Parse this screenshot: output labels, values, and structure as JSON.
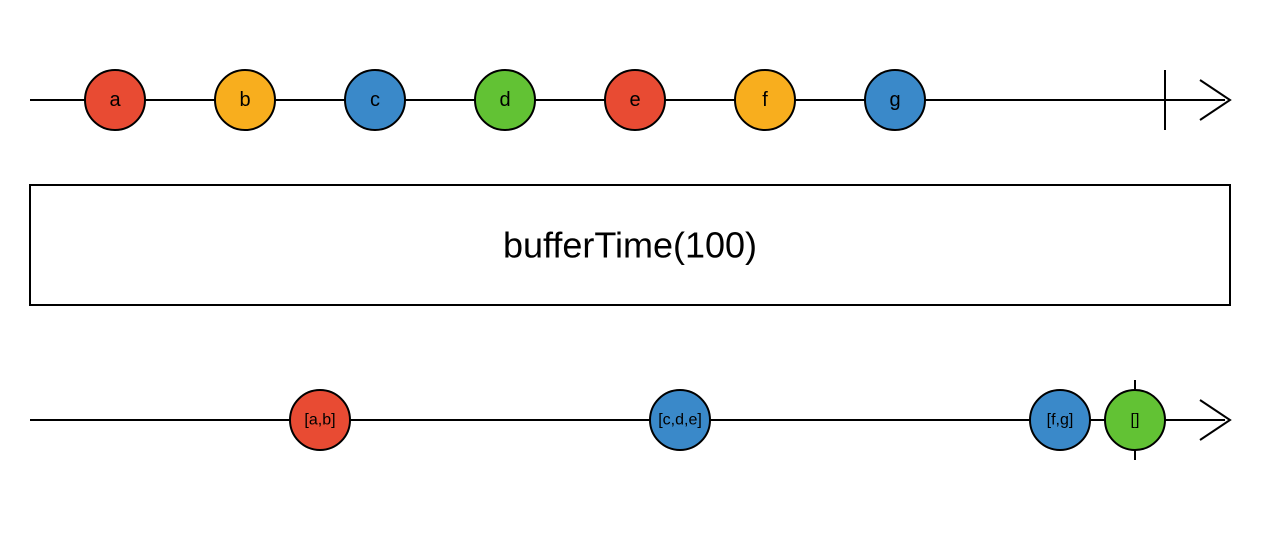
{
  "colors": {
    "red": "#e84b33",
    "yellow": "#f8ae1e",
    "blue": "#3a89c9",
    "green": "#62c234"
  },
  "operator": {
    "label": "bufferTime(100)"
  },
  "input": {
    "marbles": [
      {
        "label": "a",
        "color": "red"
      },
      {
        "label": "b",
        "color": "yellow"
      },
      {
        "label": "c",
        "color": "blue"
      },
      {
        "label": "d",
        "color": "green"
      },
      {
        "label": "e",
        "color": "red"
      },
      {
        "label": "f",
        "color": "yellow"
      },
      {
        "label": "g",
        "color": "blue"
      }
    ]
  },
  "output": {
    "marbles": [
      {
        "label": "[a,b]",
        "color": "red"
      },
      {
        "label": "[c,d,e]",
        "color": "blue"
      },
      {
        "label": "[f,g]",
        "color": "blue"
      },
      {
        "label": "[]",
        "color": "green"
      }
    ]
  },
  "chart_data": {
    "type": "marble-diagram",
    "operator": "bufferTime",
    "operator_args": [
      100
    ],
    "input_stream": {
      "events": [
        {
          "t": 10,
          "value": "a"
        },
        {
          "t": 25,
          "value": "b"
        },
        {
          "t": 40,
          "value": "c"
        },
        {
          "t": 55,
          "value": "d"
        },
        {
          "t": 70,
          "value": "e"
        },
        {
          "t": 85,
          "value": "f"
        },
        {
          "t": 100,
          "value": "g"
        }
      ],
      "complete_at": 140
    },
    "output_stream": {
      "events": [
        {
          "t": 33,
          "value": [
            "a",
            "b"
          ]
        },
        {
          "t": 75,
          "value": [
            "c",
            "d",
            "e"
          ]
        },
        {
          "t": 120,
          "value": [
            "f",
            "g"
          ]
        },
        {
          "t": 130,
          "value": []
        }
      ],
      "complete_at": 130
    }
  }
}
